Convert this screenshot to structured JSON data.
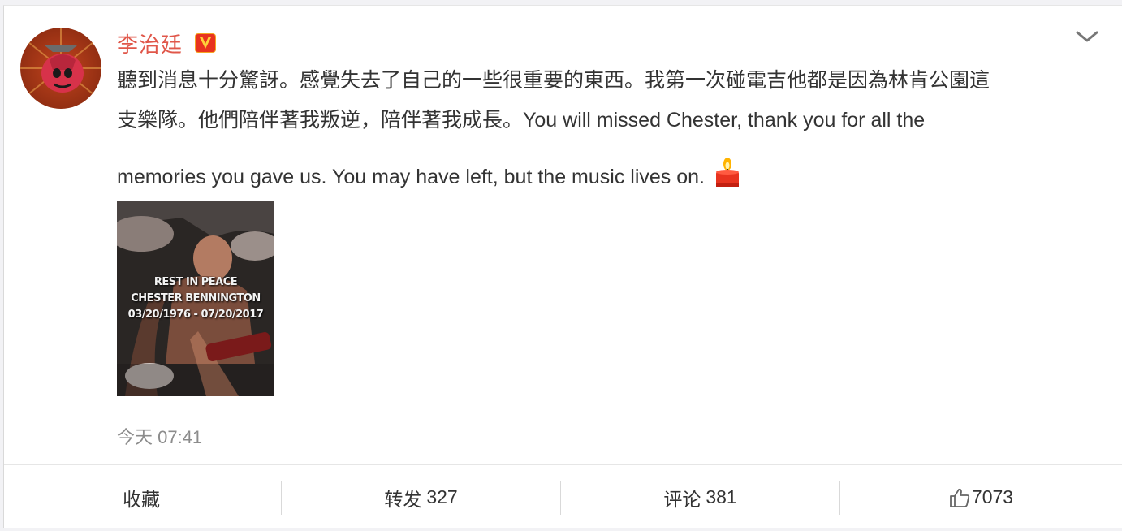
{
  "post": {
    "username": "李治廷",
    "text_line1": "聽到消息十分驚訝。感覺失去了自己的一些很重要的東西。我第一次碰電吉他都是因為林肯公園這",
    "text_line2": "支樂隊。他們陪伴著我叛逆，陪伴著我成長。You will missed Chester, thank you for all the",
    "text_line3": "memories you gave us. You may have left, but the music lives on.",
    "timestamp": "今天 07:41",
    "photo": {
      "line1": "REST IN PEACE",
      "line2": "CHESTER BENNINGTON",
      "line3": "03/20/1976 - 07/20/2017"
    }
  },
  "actions": {
    "favorite_label": "收藏",
    "repost_label": "转发",
    "repost_count": "327",
    "comment_label": "评论",
    "comment_count": "381",
    "like_count": "7073"
  },
  "icons": {
    "vip_badge": "verified-v-icon",
    "menu": "chevron-down-icon",
    "emoji": "candle-icon",
    "like": "thumbs-up-icon"
  },
  "colors": {
    "username": "#e0574a",
    "text": "#333333",
    "muted": "#8c8c8c",
    "badge": "#f5a623"
  }
}
